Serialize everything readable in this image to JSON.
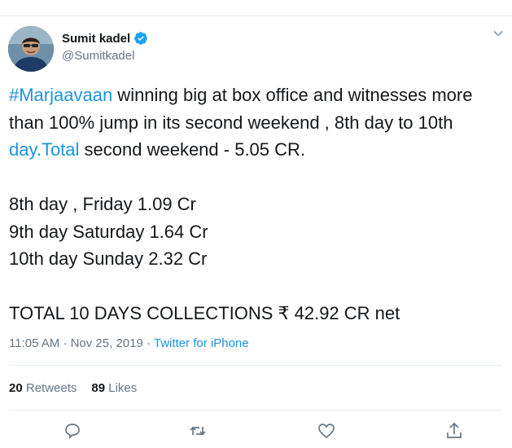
{
  "tweet": {
    "author": {
      "name": "Sumit kadel",
      "handle": "@Sumitkadel"
    },
    "text": {
      "hashtag": "#Marjaavaan",
      "part1": " winning big at box office and witnesses more than 100% jump in its second weekend , 8th day to 10th ",
      "link": "day.Total",
      "part2": " second weekend - 5.05 CR.\n\n8th day , Friday 1.09 Cr\n9th day Saturday 1.64 Cr\n10th day Sunday 2.32 Cr\n\nTOTAL 10 DAYS COLLECTIONS ₹ 42.92 CR net"
    },
    "timestamp": "11:05 AM · Nov 25, 2019 · ",
    "source": "Twitter for iPhone",
    "stats": {
      "retweets_count": "20",
      "retweets_label": "Retweets",
      "likes_count": "89",
      "likes_label": "Likes"
    }
  },
  "colors": {
    "accent": "#1b95e0",
    "muted": "#657786",
    "text": "#14171a",
    "border": "#e6ecf0"
  },
  "icons": [
    "verified-icon",
    "caret-down-icon",
    "reply-icon",
    "retweet-icon",
    "like-icon",
    "share-icon"
  ]
}
